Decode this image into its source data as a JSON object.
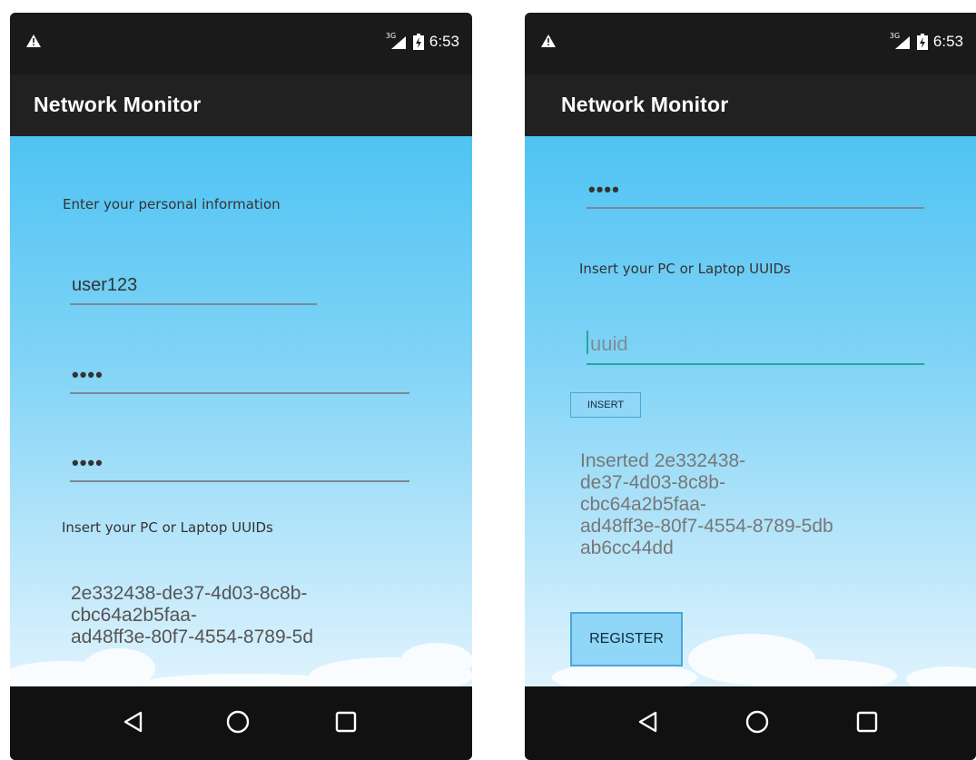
{
  "left": {
    "status": {
      "network": "3G",
      "time": "6:53"
    },
    "app_title": "Network Monitor",
    "personal_info_label": "Enter your personal information",
    "username_value": "user123",
    "password_value": "••••",
    "confirm_password_value": "••••",
    "uuid_section_label": "Insert your PC or Laptop UUIDs",
    "uuid_lines": [
      "2e332438-de37-4d03-8c8b-",
      "cbc64a2b5faa-",
      "ad48ff3e-80f7-4554-8789-5d"
    ]
  },
  "right": {
    "status": {
      "network": "3G",
      "time": "6:53"
    },
    "app_title": "Network Monitor",
    "password_value": "••••",
    "uuid_section_label": "Insert your PC or Laptop UUIDs",
    "uuid_placeholder": "uuid",
    "insert_button": "INSERT",
    "inserted_lines": [
      "Inserted 2e332438-",
      "de37-4d03-8c8b-",
      "cbc64a2b5faa-",
      "ad48ff3e-80f7-4554-8789-5db",
      "ab6cc44dd"
    ],
    "register_button": "REGISTER"
  },
  "icons": {
    "status_left": "warning-icon",
    "signal": "signal-icon",
    "battery": "battery-charging-icon",
    "nav": [
      "back-icon",
      "home-icon",
      "recents-icon"
    ]
  },
  "colors": {
    "appbar": "#212121",
    "sky_top": "#4fc3f3",
    "sky_bottom": "#dff3fd",
    "focus_accent": "#26a69a",
    "button_fill": "#8fd6f7"
  }
}
